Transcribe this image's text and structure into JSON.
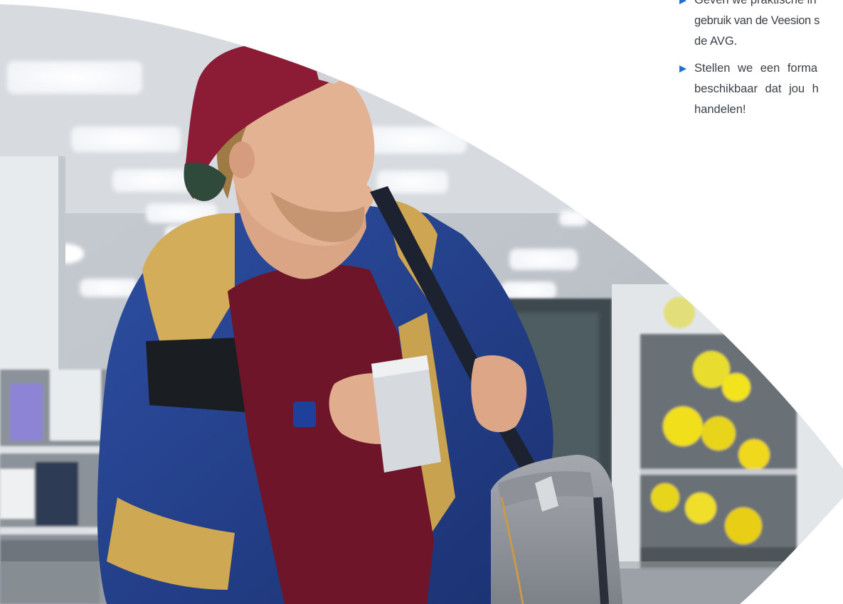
{
  "features": [
    {
      "lines": [
        "Geven we praktische in",
        "gebruik van de Veesion s",
        "de AVG."
      ]
    },
    {
      "lines": [
        "Stellen we een forma",
        "beschikbaar dat jou h",
        "handelen!"
      ]
    }
  ],
  "icons": {
    "bullet": "triangle-right-icon"
  },
  "colors": {
    "accent": "#1f6fd6",
    "text": "#3b4148",
    "background": "#ffffff"
  }
}
